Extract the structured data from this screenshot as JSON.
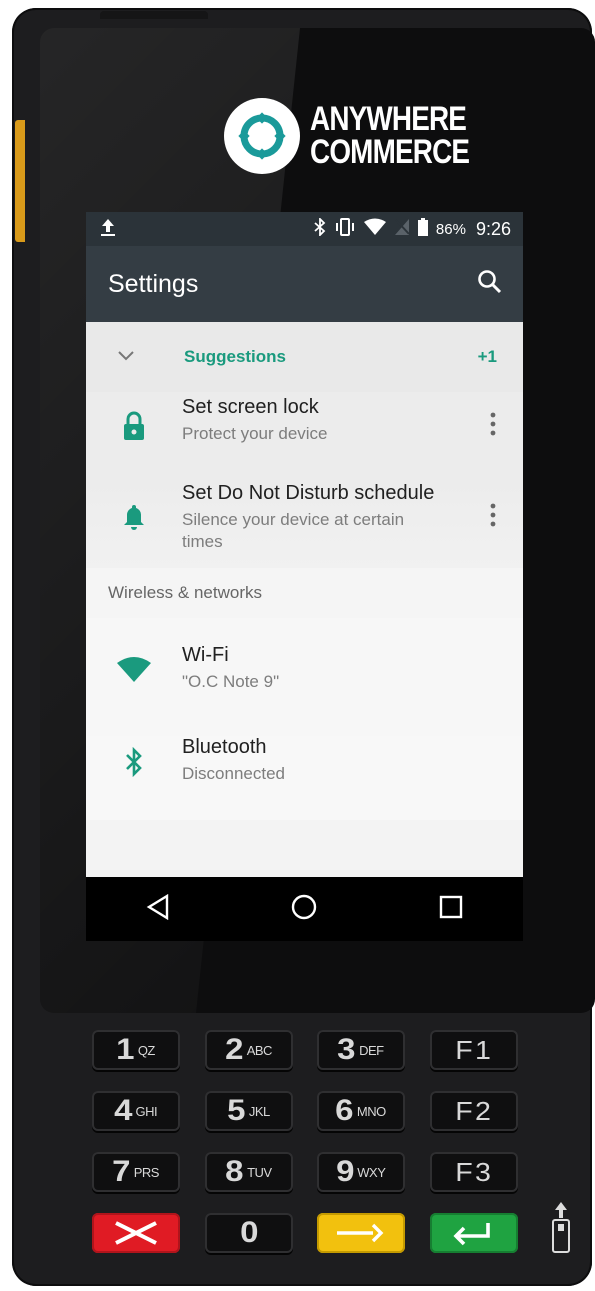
{
  "brand": {
    "line1": "ANYWHERE",
    "line2": "COMMERCE",
    "color": "#1a9a9a"
  },
  "status_bar": {
    "upload_icon": "upload-icon",
    "battery_percent": "86%",
    "time": "9:26"
  },
  "app_bar": {
    "title": "Settings",
    "search_icon": "search-icon"
  },
  "suggestions": {
    "label": "Suggestions",
    "count": "+1",
    "items": [
      {
        "title": "Set screen lock",
        "subtitle": "Protect your device",
        "icon": "lock-icon"
      },
      {
        "title": "Set Do Not Disturb schedule",
        "subtitle": "Silence your device at certain times",
        "icon": "bell-icon"
      }
    ]
  },
  "section": {
    "label": "Wireless & networks",
    "items": [
      {
        "title": "Wi-Fi",
        "subtitle": "\"O.C Note 9\"",
        "icon": "wifi-icon"
      },
      {
        "title": "Bluetooth",
        "subtitle": "Disconnected",
        "icon": "bluetooth-icon"
      }
    ]
  },
  "keypad": {
    "rows": [
      [
        {
          "big": "1",
          "small": "QZ"
        },
        {
          "big": "2",
          "small": "ABC"
        },
        {
          "big": "3",
          "small": "DEF"
        },
        {
          "big": "F1",
          "small": ""
        }
      ],
      [
        {
          "big": "4",
          "small": "GHI"
        },
        {
          "big": "5",
          "small": "JKL"
        },
        {
          "big": "6",
          "small": "MNO"
        },
        {
          "big": "F2",
          "small": ""
        }
      ],
      [
        {
          "big": "7",
          "small": "PRS"
        },
        {
          "big": "8",
          "small": "TUV"
        },
        {
          "big": "9",
          "small": "WXY"
        },
        {
          "big": "F3",
          "small": ""
        }
      ],
      [
        {
          "big": "",
          "small": ""
        },
        {
          "big": "0",
          "small": ""
        },
        {
          "big": "",
          "small": ""
        },
        {
          "big": "",
          "small": ""
        }
      ]
    ]
  },
  "colors": {
    "accent": "#1a9a7e",
    "cancel": "#e01b24",
    "clear": "#f2c10e",
    "enter": "#1fa341"
  }
}
